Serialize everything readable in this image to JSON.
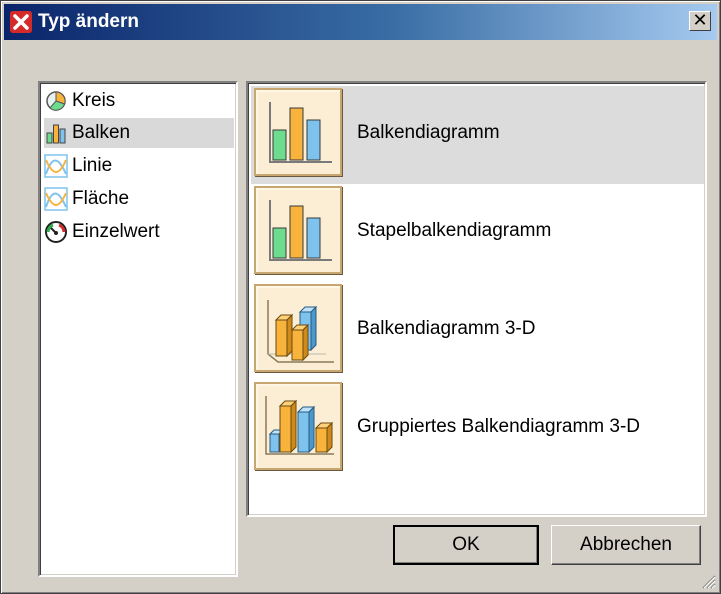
{
  "dialog": {
    "title": "Typ ändern",
    "close_symbol": "✕"
  },
  "categories": [
    {
      "label": "Kreis",
      "icon": "pie-chart-icon",
      "selected": false
    },
    {
      "label": "Balken",
      "icon": "bar-chart-icon",
      "selected": true
    },
    {
      "label": "Linie",
      "icon": "line-chart-icon",
      "selected": false
    },
    {
      "label": "Fläche",
      "icon": "area-chart-icon",
      "selected": false
    },
    {
      "label": "Einzelwert",
      "icon": "gauge-icon",
      "selected": false
    }
  ],
  "chart_types": [
    {
      "label": "Balkendiagramm",
      "icon": "bar-chart-thumb-icon",
      "selected": true
    },
    {
      "label": "Stapelbalkendiagramm",
      "icon": "stacked-bar-chart-thumb-icon",
      "selected": false
    },
    {
      "label": "Balkendiagramm 3-D",
      "icon": "bar-chart-3d-thumb-icon",
      "selected": false
    },
    {
      "label": "Gruppiertes Balkendiagramm 3-D",
      "icon": "grouped-bar-chart-3d-thumb-icon",
      "selected": false
    }
  ],
  "buttons": {
    "ok_label": "OK",
    "cancel_label": "Abbrechen"
  },
  "colors": {
    "titlebar_start": "#0a246a",
    "titlebar_end": "#a6caf0",
    "dialog_bg": "#d4d0c8",
    "thumb_bg": "#fbeed5",
    "bar_green": "#6ddc8e",
    "bar_orange": "#f7b33c",
    "bar_blue": "#7ec3ee"
  }
}
